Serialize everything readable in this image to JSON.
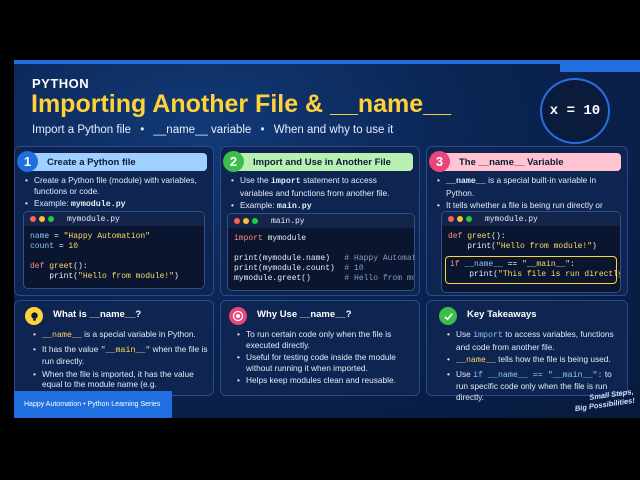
{
  "colors": {
    "accent": "#ffd23a",
    "blue": "#1f6fe0",
    "green": "#3bbf4a",
    "pink": "#e9457a",
    "header_blue": "#9fd0ff",
    "header_green": "#b7f0b0",
    "header_pink": "#ffc4cf"
  },
  "header": {
    "kicker": "PYTHON",
    "title": "Importing Another File & __name__",
    "subtitle_parts": [
      "Import a Python file",
      "•",
      "__name__ variable",
      "•",
      "When and why to use it"
    ],
    "badge": "x = 10"
  },
  "cards": [
    {
      "number": "1",
      "title": "Create a Python file",
      "bullets": [
        "Create a Python file (module) with variables, functions or code.",
        "Example: mymodule.py"
      ],
      "code_file": "mymodule.py",
      "code_lines": [
        "name = \"Happy Automation\"",
        "count = 10",
        "",
        "def greet():",
        "    print(\"Hello from module!\")"
      ]
    },
    {
      "number": "2",
      "title": "Import and Use in Another File",
      "bullets": [
        "Use the import statement to access variables and functions from another file.",
        "Example: main.py"
      ],
      "code_file": "main.py",
      "code_lines": [
        "import mymodule",
        "",
        "print(mymodule.name)",
        "print(mymodule.count)",
        "mymodule.greet()"
      ],
      "code_comments": [
        "# Happy Automation",
        "# 10",
        "# Hello from module!"
      ]
    },
    {
      "number": "3",
      "title": "The __name__ Variable",
      "bullets": [
        "__name__ is a special built-in variable in Python.",
        "It tells whether a file is being run directly or imported as a module."
      ],
      "code_file": "mymodule.py",
      "code_lines": [
        "def greet():",
        "    print(\"Hello from module!\")",
        "if __name__ == \"__main__\":",
        "    print(\"This file is run directly\")"
      ]
    }
  ],
  "bottom_cards": [
    {
      "icon": "lightbulb-icon",
      "title": "What is __name__?",
      "bullets": [
        "__name__ is a special variable in Python.",
        "It has the value \"__main__\" when the file is run directly.",
        "When the file is imported, it has the value equal to the module name (e.g. \"mymodule\")."
      ]
    },
    {
      "icon": "target-icon",
      "title": "Why Use __name__?",
      "bullets": [
        "To run certain code only when the file is executed directly.",
        "Useful for testing code inside the module without running it when imported.",
        "Helps keep modules clean and reusable."
      ]
    },
    {
      "icon": "checkmark-icon",
      "title": "Key Takeaways",
      "bullets": [
        "Use import to access variables, functions and code from another file.",
        "__name__ tells how the file is being used.",
        "Use if __name__ == \"__main__\": to run specific code only when the file is run directly."
      ]
    }
  ],
  "footer": {
    "series": "Happy Automation • Python Learning Series",
    "tagline_line1": "Small Steps,",
    "tagline_line2": "Big Possibilities!"
  }
}
